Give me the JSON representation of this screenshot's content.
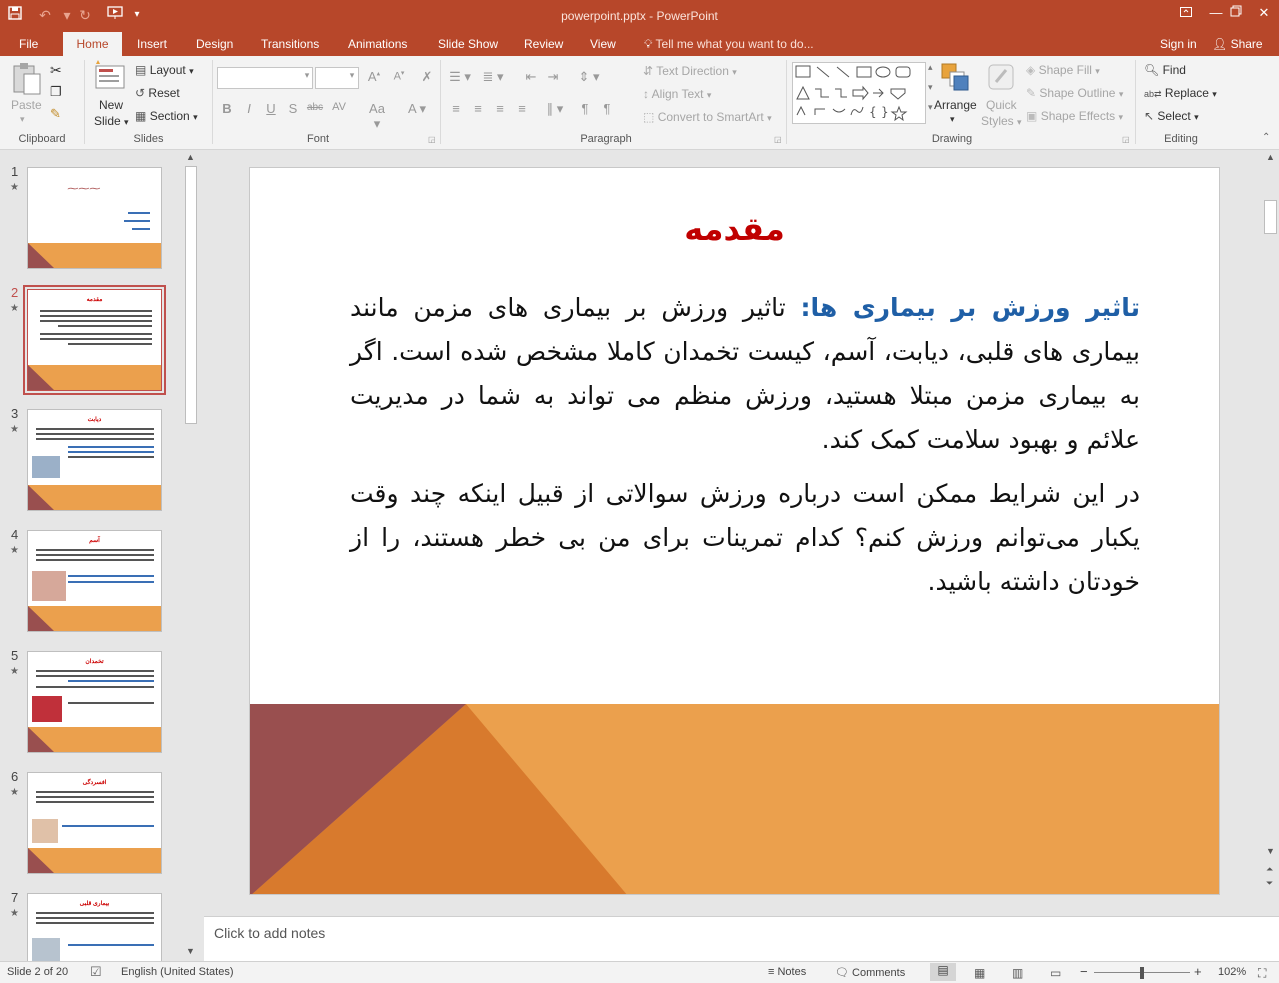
{
  "titlebar": {
    "title": "powerpoint.pptx - PowerPoint",
    "accent": "#b7472a"
  },
  "tabs": {
    "file": "File",
    "home": "Home",
    "insert": "Insert",
    "design": "Design",
    "transitions": "Transitions",
    "animations": "Animations",
    "slideshow": "Slide Show",
    "review": "Review",
    "view": "View",
    "tellme": "Tell me what you want to do...",
    "signin": "Sign in",
    "share": "Share"
  },
  "ribbon": {
    "clipboard": {
      "label": "Clipboard",
      "paste": "Paste"
    },
    "slides": {
      "label": "Slides",
      "new_slide_1": "New",
      "new_slide_2": "Slide",
      "layout": "Layout",
      "reset": "Reset",
      "section": "Section"
    },
    "font": {
      "label": "Font"
    },
    "paragraph": {
      "label": "Paragraph",
      "text_direction": "Text Direction",
      "align_text": "Align Text",
      "convert_smartart": "Convert to SmartArt"
    },
    "drawing": {
      "label": "Drawing",
      "arrange": "Arrange",
      "quick_styles_1": "Quick",
      "quick_styles_2": "Styles",
      "shape_fill": "Shape Fill",
      "shape_outline": "Shape Outline",
      "shape_effects": "Shape Effects"
    },
    "editing": {
      "label": "Editing",
      "find": "Find",
      "replace": "Replace",
      "select": "Select"
    }
  },
  "thumbnails": [
    {
      "num": "1",
      "title": ""
    },
    {
      "num": "2",
      "title": "مقدمه"
    },
    {
      "num": "3",
      "title": "دیابت"
    },
    {
      "num": "4",
      "title": "آسم"
    },
    {
      "num": "5",
      "title": "تخمدان"
    },
    {
      "num": "6",
      "title": "افسردگی"
    },
    {
      "num": "7",
      "title": "بیماری قلبی"
    }
  ],
  "slide": {
    "title": "مقدمه",
    "para1_highlight": "تاثیر ورزش بر بیماری ها:",
    "para1_text": " تاثیر ورزش بر بیماری های مزمن مانند بیماری های قلبی، دیابت، آسم، کیست تخمدان کاملا مشخص شده است. اگر به بیماری مزمن مبتلا هستید، ورزش منظم می تواند به شما در مدیریت علائم و بهبود سلامت کمک کند.",
    "para2_text": "در این شرایط ممکن است درباره ورزش سوالاتی از قبیل اینکه چند وقت یکبار می‌توانم ورزش کنم؟ کدام تمرینات برای من بی خطر هستند، را از خودتان داشته باشید.",
    "title_color": "#c00000",
    "highlight_color": "#1f5fa6"
  },
  "notes": {
    "placeholder": "Click to add notes"
  },
  "statusbar": {
    "slide_info": "Slide 2 of 20",
    "language": "English (United States)",
    "notes": "Notes",
    "comments": "Comments",
    "zoom": "102%"
  }
}
